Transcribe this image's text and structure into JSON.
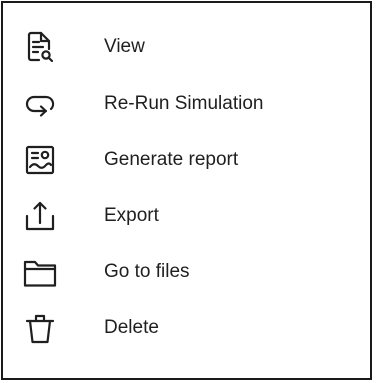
{
  "menu": {
    "items": [
      {
        "label": "View",
        "icon": "document-search-icon"
      },
      {
        "label": "Re-Run Simulation",
        "icon": "loop-arrow-icon"
      },
      {
        "label": "Generate report",
        "icon": "report-image-icon"
      },
      {
        "label": "Export",
        "icon": "export-upload-icon"
      },
      {
        "label": "Go to files",
        "icon": "folder-icon"
      },
      {
        "label": "Delete",
        "icon": "trash-icon"
      }
    ]
  }
}
